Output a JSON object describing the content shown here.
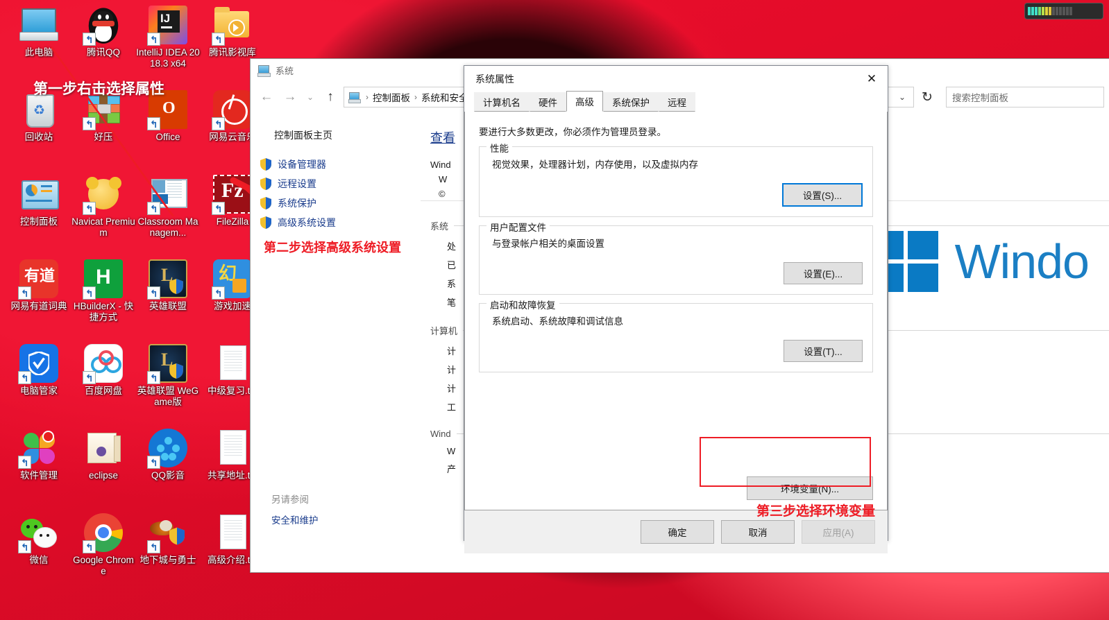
{
  "desktop": {
    "icons": [
      {
        "label": "此电脑",
        "icon": "this-pc-icon",
        "shortcut": false
      },
      {
        "label": "腾讯QQ",
        "icon": "tencent-qq-icon",
        "shortcut": true
      },
      {
        "label": "IntelliJ IDEA 2018.3 x64",
        "icon": "intellij-idea-icon",
        "shortcut": true
      },
      {
        "label": "腾讯影视库",
        "icon": "tencent-video-icon",
        "shortcut": true
      },
      {
        "label": "回收站",
        "icon": "recycle-bin-icon",
        "shortcut": false
      },
      {
        "label": "好压",
        "icon": "haozip-icon",
        "shortcut": true
      },
      {
        "label": "Office",
        "icon": "office-icon",
        "shortcut": true
      },
      {
        "label": "网易云音乐",
        "icon": "netease-music-icon",
        "shortcut": true
      },
      {
        "label": "控制面板",
        "icon": "control-panel-icon",
        "shortcut": false
      },
      {
        "label": "Navicat Premium",
        "icon": "navicat-icon",
        "shortcut": true
      },
      {
        "label": "Classroom Managem...",
        "icon": "classroom-management-icon",
        "shortcut": true
      },
      {
        "label": "FileZilla",
        "icon": "filezilla-icon",
        "shortcut": true
      },
      {
        "label": "网易有道词典",
        "icon": "youdao-dict-icon",
        "shortcut": true
      },
      {
        "label": "HBuilderX - 快捷方式",
        "icon": "hbuilderx-icon",
        "shortcut": true
      },
      {
        "label": "英雄联盟",
        "icon": "league-of-legends-icon",
        "shortcut": true
      },
      {
        "label": "游戏加速",
        "icon": "game-booster-icon",
        "shortcut": true
      },
      {
        "label": "电脑管家",
        "icon": "pc-manager-icon",
        "shortcut": true
      },
      {
        "label": "百度网盘",
        "icon": "baidu-netdisk-icon",
        "shortcut": true
      },
      {
        "label": "英雄联盟 WeGame版",
        "icon": "lol-wegame-icon",
        "shortcut": true
      },
      {
        "label": "中级复习.txt",
        "icon": "text-file-icon",
        "shortcut": false
      },
      {
        "label": "软件管理",
        "icon": "software-manager-icon",
        "shortcut": true
      },
      {
        "label": "eclipse",
        "icon": "eclipse-folder-icon",
        "shortcut": false
      },
      {
        "label": "QQ影音",
        "icon": "qq-player-icon",
        "shortcut": true
      },
      {
        "label": "共享地址.txt",
        "icon": "text-file-icon",
        "shortcut": false
      },
      {
        "label": "微信",
        "icon": "wechat-icon",
        "shortcut": true
      },
      {
        "label": "Google Chrome",
        "icon": "chrome-icon",
        "shortcut": true
      },
      {
        "label": "地下城与勇士",
        "icon": "dnf-icon",
        "shortcut": true
      },
      {
        "label": "高级介绍.txt",
        "icon": "text-file-icon",
        "shortcut": false
      }
    ],
    "annotations": {
      "step1": "第一步右击选择属性",
      "step2": "第二步选择高级系统设置",
      "step3": "第三步选择环境变量"
    },
    "colors": {
      "wallpaper": "#e8112d",
      "annotation_red": "#ee1c25",
      "annotation_white": "#ffffff",
      "accent_blue": "#0078d7"
    }
  },
  "explorer": {
    "title": "系统",
    "nav": {
      "back": "←",
      "forward": "→",
      "recent": "⌄",
      "up": "↑"
    },
    "breadcrumb": {
      "items": [
        "控制面板",
        "系统和安全"
      ],
      "separator": "›",
      "dropdown": "⌄",
      "refresh": "↻"
    },
    "search": {
      "placeholder": "搜索控制面板"
    },
    "sidebar": {
      "home": "控制面板主页",
      "items": [
        {
          "label": "设备管理器",
          "icon": "shield-icon"
        },
        {
          "label": "远程设置",
          "icon": "shield-icon"
        },
        {
          "label": "系统保护",
          "icon": "shield-icon"
        },
        {
          "label": "高级系统设置",
          "icon": "shield-icon"
        }
      ],
      "see_also_title": "另请参阅",
      "see_also_link": "安全和维护"
    },
    "main": {
      "heading": "查看",
      "win_line": "Wind",
      "win_sub1": "W",
      "copyright": "©",
      "group_system": "系统",
      "system_rows": [
        "处",
        "已",
        "系",
        "笔"
      ],
      "group_computer": "计算机",
      "computer_rows": [
        "计",
        "计",
        "计",
        "工"
      ],
      "group_windows": "Wind",
      "windows_rows": [
        "W",
        "产"
      ],
      "brand_text": "Windo"
    }
  },
  "sysprops": {
    "title": "系统属性",
    "close_label": "✕",
    "tabs": [
      {
        "label": "计算机名",
        "active": false
      },
      {
        "label": "硬件",
        "active": false
      },
      {
        "label": "高级",
        "active": true
      },
      {
        "label": "系统保护",
        "active": false
      },
      {
        "label": "远程",
        "active": false
      }
    ],
    "lead": "要进行大多数更改，你必须作为管理员登录。",
    "groups": [
      {
        "legend": "性能",
        "description": "视觉效果，处理器计划，内存使用，以及虚拟内存",
        "button": "设置(S)...",
        "focused": true
      },
      {
        "legend": "用户配置文件",
        "description": "与登录帐户相关的桌面设置",
        "button": "设置(E)...",
        "focused": false
      },
      {
        "legend": "启动和故障恢复",
        "description": "系统启动、系统故障和调试信息",
        "button": "设置(T)...",
        "focused": false
      }
    ],
    "env_button": "环境变量(N)...",
    "footer": {
      "ok": "确定",
      "cancel": "取消",
      "apply": "应用(A)"
    }
  }
}
